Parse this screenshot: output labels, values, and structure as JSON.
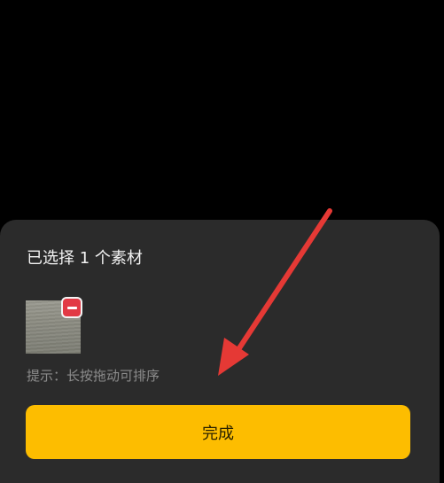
{
  "sheet": {
    "title": "已选择 1 个素材",
    "selected_items": [
      {
        "thumbnail_icon": "image-thumbnail",
        "remove_icon": "minus-icon"
      }
    ],
    "hint": "提示：长按拖动可排序",
    "done_label": "完成"
  },
  "colors": {
    "background": "#000000",
    "sheet": "#2b2b2b",
    "accent": "#fdbd00",
    "remove": "#e23a45",
    "annotation_arrow": "#e53935"
  }
}
